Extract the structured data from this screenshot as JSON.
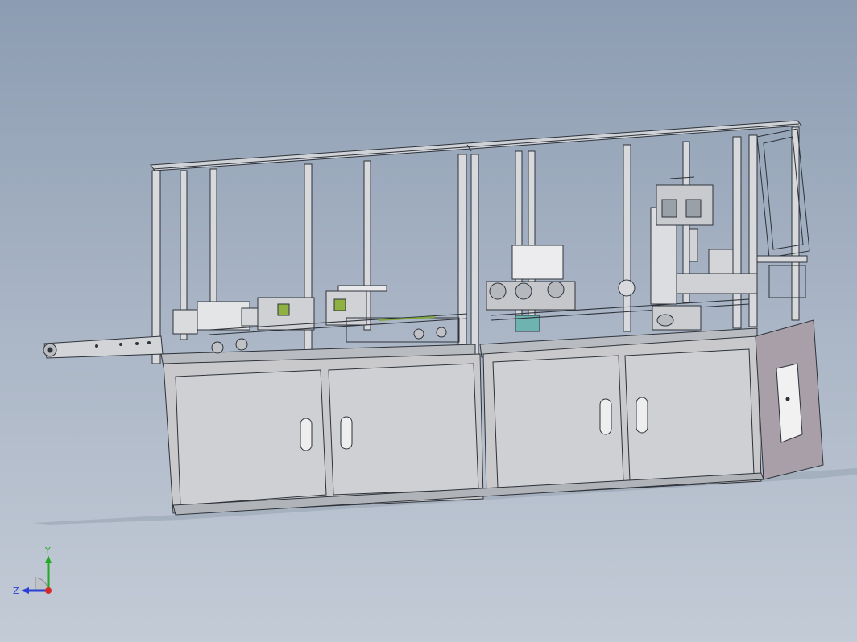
{
  "viewport": {
    "background_top": "#8c9cb2",
    "background_bottom": "#c3cbd6",
    "model_frame_color": "#2e333a",
    "model_panel_color": "#c9c9cc",
    "model_side_panel_color": "#a99fa9",
    "model_accent_green": "#7fa63a"
  },
  "triad": {
    "y_label": "Y",
    "z_label": "Z",
    "x_color": "#d42a2a",
    "y_color": "#22aa22",
    "z_color": "#2a3fd4"
  }
}
